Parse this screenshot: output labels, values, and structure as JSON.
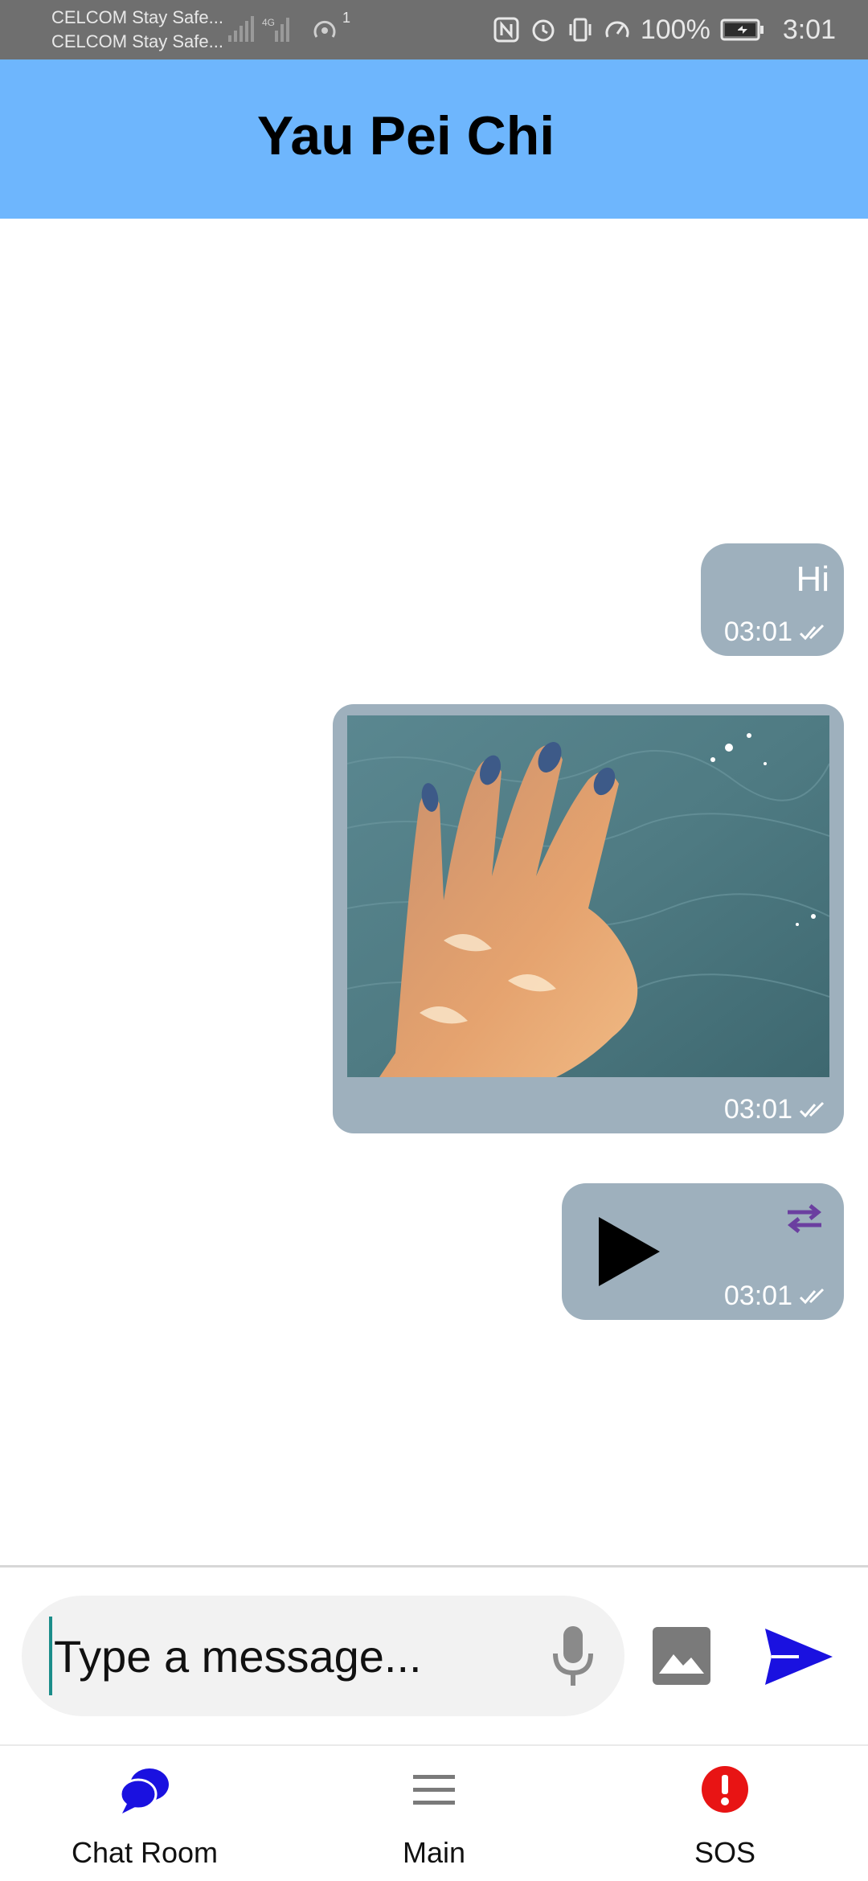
{
  "status_bar": {
    "carrier_1": "CELCOM Stay Safe...",
    "carrier_2": "CELCOM Stay Safe...",
    "hotspot_count": "1",
    "battery": "100%",
    "time": "3:01"
  },
  "header": {
    "title": "Yau Pei Chi",
    "background": "#6eb6fd"
  },
  "messages": [
    {
      "type": "text",
      "text": "Hi",
      "time": "03:01"
    },
    {
      "type": "image",
      "time": "03:01"
    },
    {
      "type": "audio",
      "time": "03:01"
    }
  ],
  "composer": {
    "placeholder": "Type a message...",
    "send_color": "#1a11e0"
  },
  "bottom_nav": {
    "items": [
      {
        "label": "Chat Room",
        "icon": "chat-bubbles-icon",
        "color": "#1a11e0"
      },
      {
        "label": "Main",
        "icon": "menu-icon",
        "color": "#7a7a7a"
      },
      {
        "label": "SOS",
        "icon": "alert-icon",
        "color": "#e81414"
      }
    ]
  },
  "colors": {
    "bubble": "#9eb0bd",
    "status_bar": "#6f6f6f"
  }
}
